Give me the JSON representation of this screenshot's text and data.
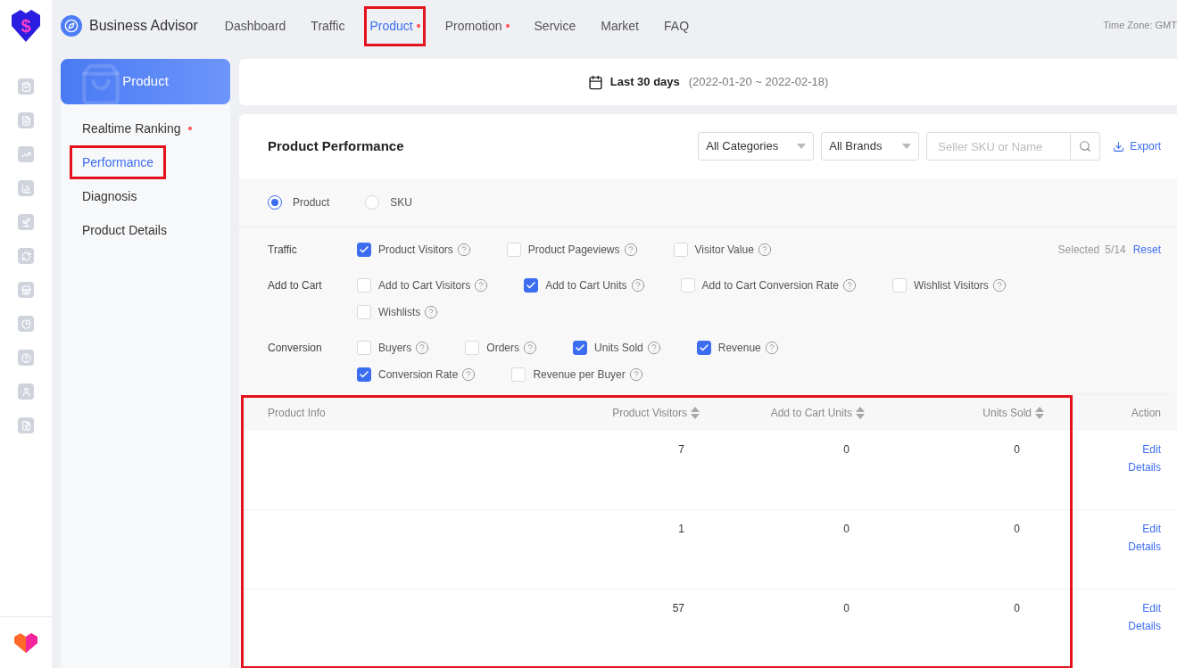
{
  "logo": {
    "symbol": "$"
  },
  "nav": {
    "brand": "Business Advisor",
    "items": [
      {
        "label": "Dashboard",
        "selected": false,
        "dot": false,
        "highlighted": false
      },
      {
        "label": "Traffic",
        "selected": false,
        "dot": false,
        "highlighted": false
      },
      {
        "label": "Product",
        "selected": true,
        "dot": true,
        "highlighted": true
      },
      {
        "label": "Promotion",
        "selected": false,
        "dot": true,
        "highlighted": false
      },
      {
        "label": "Service",
        "selected": false,
        "dot": false,
        "highlighted": false
      },
      {
        "label": "Market",
        "selected": false,
        "dot": false,
        "highlighted": false
      },
      {
        "label": "FAQ",
        "selected": false,
        "dot": false,
        "highlighted": false
      }
    ],
    "timezone": "Time Zone: GMT"
  },
  "submenu": {
    "title": "Product",
    "items": [
      {
        "label": "Realtime Ranking",
        "selected": false,
        "dot": true,
        "highlighted": false
      },
      {
        "label": "Performance",
        "selected": true,
        "dot": false,
        "highlighted": true
      },
      {
        "label": "Diagnosis",
        "selected": false,
        "dot": false,
        "highlighted": false
      },
      {
        "label": "Product Details",
        "selected": false,
        "dot": false,
        "highlighted": false
      }
    ]
  },
  "date": {
    "label": "Last 30 days",
    "range": "(2022-01-20 ~ 2022-02-18)"
  },
  "panel": {
    "title": "Product Performance",
    "category": "All Categories",
    "brand": "All Brands",
    "search_placeholder": "Seller SKU or Name",
    "export": "Export",
    "views": [
      {
        "label": "Product",
        "selected": true
      },
      {
        "label": "SKU",
        "selected": false
      }
    ],
    "selected_label": "Selected",
    "selected_count": "5/14",
    "reset": "Reset",
    "groups": [
      {
        "name": "Traffic",
        "lines": [
          [
            {
              "label": "Product Visitors",
              "checked": true
            },
            {
              "label": "Product Pageviews",
              "checked": false
            },
            {
              "label": "Visitor Value",
              "checked": false
            }
          ]
        ]
      },
      {
        "name": "Add to Cart",
        "lines": [
          [
            {
              "label": "Add to Cart Visitors",
              "checked": false
            },
            {
              "label": "Add to Cart Units",
              "checked": true
            },
            {
              "label": "Add to Cart Conversion Rate",
              "checked": false
            },
            {
              "label": "Wishlist Visitors",
              "checked": false
            }
          ],
          [
            {
              "label": "Wishlists",
              "checked": false
            }
          ]
        ]
      },
      {
        "name": "Conversion",
        "lines": [
          [
            {
              "label": "Buyers",
              "checked": false
            },
            {
              "label": "Orders",
              "checked": false
            },
            {
              "label": "Units Sold",
              "checked": true
            },
            {
              "label": "Revenue",
              "checked": true
            }
          ],
          [
            {
              "label": "Conversion Rate",
              "checked": true
            },
            {
              "label": "Revenue per Buyer",
              "checked": false
            }
          ]
        ]
      }
    ]
  },
  "table": {
    "info_column": "Product Info",
    "columns": [
      "Product Visitors",
      "Add to Cart Units",
      "Units Sold"
    ],
    "action_column": "Action",
    "highlighted": true,
    "rows": [
      {
        "values": [
          "7",
          "0",
          "0"
        ],
        "actions": [
          "Edit",
          "Details"
        ]
      },
      {
        "values": [
          "1",
          "0",
          "0"
        ],
        "actions": [
          "Edit",
          "Details"
        ]
      },
      {
        "values": [
          "57",
          "0",
          "0"
        ],
        "actions": [
          "Edit",
          "Details"
        ]
      }
    ]
  }
}
